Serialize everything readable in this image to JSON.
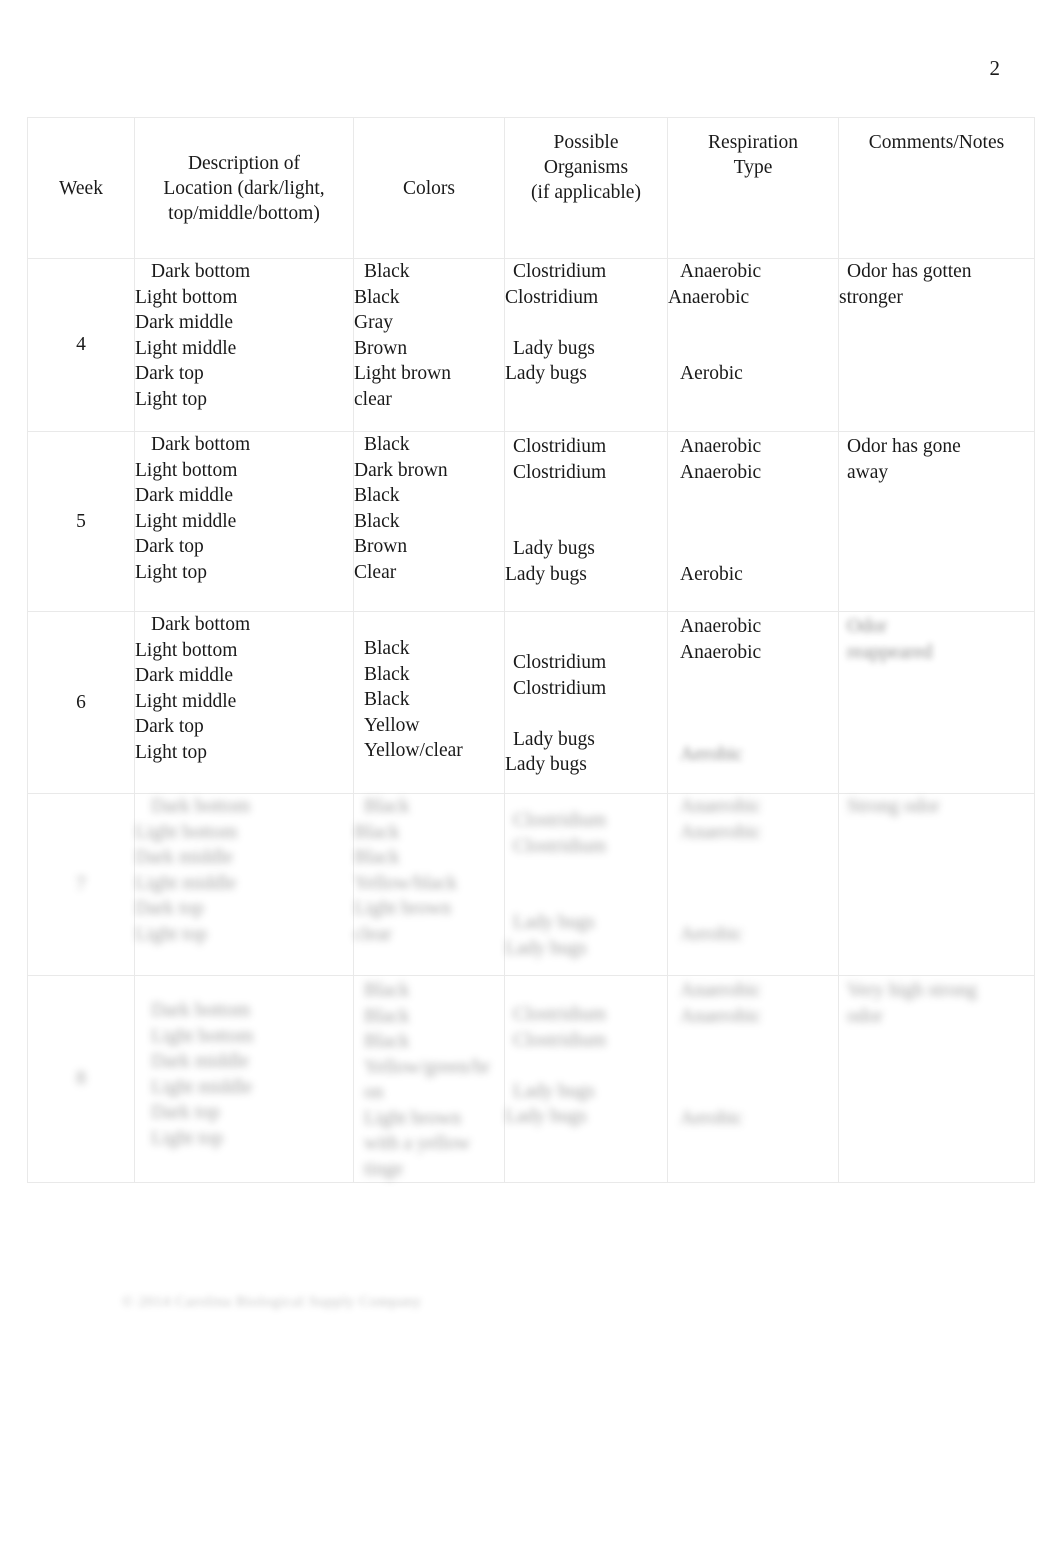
{
  "document": {
    "page_number": "2",
    "footer": "© 2014 Carolina Biological Supply Company"
  },
  "table": {
    "headers": {
      "week": "Week",
      "description": "Description of\nLocation (dark/light,\ntop/middle/bottom)",
      "colors": "Colors",
      "organisms": "Possible\nOrganisms\n(if applicable)",
      "respiration": "Respiration\nType",
      "comments": "Comments/Notes"
    },
    "rows": [
      {
        "week": "4",
        "description": "Dark bottom\nLight bottom\nDark middle\nLight middle\nDark top\nLight top",
        "colors": "Black\nBlack\nGray\nBrown\nLight brown\nclear",
        "organisms_top": "Clostridium\nClostridium",
        "organisms_bottom": "Lady bugs\nLady bugs",
        "respiration_top": "Anaerobic\nAnaerobic",
        "respiration_bottom": "Aerobic",
        "comments": "Odor has gotten\nstronger",
        "blurred": false
      },
      {
        "week": "5",
        "description": "Dark bottom\nLight bottom\nDark middle\nLight middle\nDark top\nLight top",
        "colors": "Black\nDark brown\nBlack\nBlack\nBrown\nClear",
        "organisms_top": "Clostridium\nClostridium",
        "organisms_bottom": "Lady bugs\nLady bugs",
        "respiration_top": "Anaerobic\nAnaerobic",
        "respiration_bottom": "Aerobic",
        "comments": "Odor has gone\naway",
        "blurred": false
      },
      {
        "week": "6",
        "description": "Dark bottom\nLight bottom\nDark middle\nLight middle\nDark top\nLight top",
        "colors": "Black\nBlack\nBlack\nYellow\nYellow/clear",
        "organisms_top": "Clostridium\nClostridium",
        "organisms_bottom": "Lady bugs\nLady bugs",
        "respiration_top": "Anaerobic\nAnaerobic",
        "respiration_bottom": "Aerobic",
        "comments": "Odor\nreappeared",
        "blurred": "partial"
      },
      {
        "week": "7",
        "description": "Dark bottom\nLight bottom\nDark middle\nLight middle\nDark top\nLight top",
        "colors": "Black\nBlack\nBlack\nYellow/black\nLight brown\nclear",
        "organisms_top": "Clostridium\nClostridium",
        "organisms_bottom": "Lady bugs\nLady bugs",
        "respiration_top": "Anaerobic\nAnaerobic",
        "respiration_bottom": "Aerobic",
        "comments": "Strong odor",
        "blurred": true
      },
      {
        "week": "8",
        "description": "Dark bottom\nLight bottom\nDark middle\nLight middle\nDark top\nLight top",
        "colors": "Black\nBlack\nBlack\nYellow/green/br\non\nLight brown\nwith a yellow\ntinge",
        "organisms_top": "Clostridium\nClostridium",
        "organisms_bottom": "Lady bugs\nLady bugs",
        "respiration_top": "Anaerobic\nAnaerobic",
        "respiration_bottom": "Aerobic",
        "comments": "Very high strong\nodor",
        "blurred": true
      }
    ]
  }
}
